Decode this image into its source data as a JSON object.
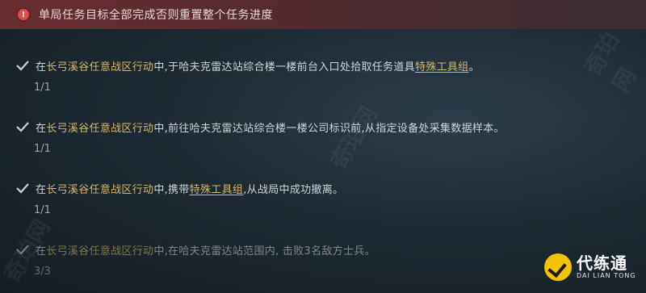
{
  "warning": {
    "text": "单局任务目标全部完成否则重置整个任务进度",
    "icon": "alert-icon",
    "color": "#6b2d31"
  },
  "tasks": [
    {
      "prefix": "在",
      "location": "长弓溪谷任意战区行动",
      "middle": "中,于哈夫克雷达站综合楼一楼前台入口处拾取任务道具",
      "item": "特殊工具组",
      "suffix": "。",
      "progress": "1/1"
    },
    {
      "prefix": "在",
      "location": "长弓溪谷任意战区行动",
      "middle": "中,前往哈夫克雷达站综合楼一楼公司标识前,从指定设备处采集数据样本。",
      "item": "",
      "suffix": "",
      "progress": "1/1"
    },
    {
      "prefix": "在",
      "location": "长弓溪谷任意战区行动",
      "middle": "中,携带",
      "item": "特殊工具组",
      "suffix": ",从战局中成功撤离。",
      "progress": "1/1"
    },
    {
      "prefix": "在",
      "location": "长弓溪谷任意战区行动",
      "middle": "中,在哈夫克雷达站范围内, 击败3名敌方士兵。",
      "item": "",
      "suffix": "",
      "progress": "3/3"
    }
  ],
  "watermarks": [
    "奇珀网",
    "奇珀网",
    "奇珀网"
  ],
  "logo": {
    "main": "代练通",
    "sub": "DAI LIAN TONG",
    "accent": "#f2c400"
  }
}
